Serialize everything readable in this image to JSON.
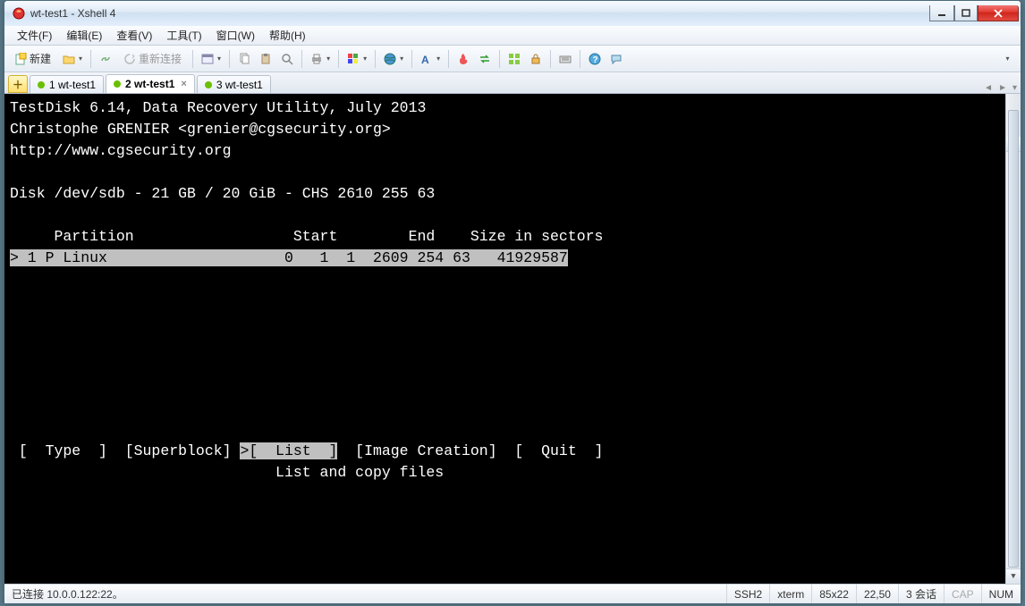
{
  "window": {
    "title": "wt-test1 - Xshell 4"
  },
  "menu": {
    "file": "文件(F)",
    "edit": "编辑(E)",
    "view": "查看(V)",
    "tools": "工具(T)",
    "window": "窗口(W)",
    "help": "帮助(H)"
  },
  "toolbar": {
    "new": "新建",
    "reconnect": "重新连接"
  },
  "tabs": {
    "items": [
      {
        "label": "1 wt-test1",
        "active": false
      },
      {
        "label": "2 wt-test1",
        "active": true
      },
      {
        "label": "3 wt-test1",
        "active": false
      }
    ]
  },
  "terminal": {
    "line1": "TestDisk 6.14, Data Recovery Utility, July 2013",
    "line2": "Christophe GRENIER <grenier@cgsecurity.org>",
    "line3": "http://www.cgsecurity.org",
    "line4": "",
    "line5": "Disk /dev/sdb - 21 GB / 20 GiB - CHS 2610 255 63",
    "line6": "",
    "header": "     Partition                  Start        End    Size in sectors",
    "row": "> 1 P Linux                    0   1  1  2609 254 63   41929587",
    "menu_pre": " [  Type  ]  [Superblock] ",
    "menu_sel": ">[  List  ]",
    "menu_post": "  [Image Creation]  [  Quit  ] ",
    "hint": "                              List and copy files"
  },
  "status": {
    "conn": "已连接 10.0.0.122:22。",
    "proto": "SSH2",
    "term": "xterm",
    "size": "85x22",
    "pos": "22,50",
    "sessions": "3 会话",
    "cap": "CAP",
    "num": "NUM"
  }
}
